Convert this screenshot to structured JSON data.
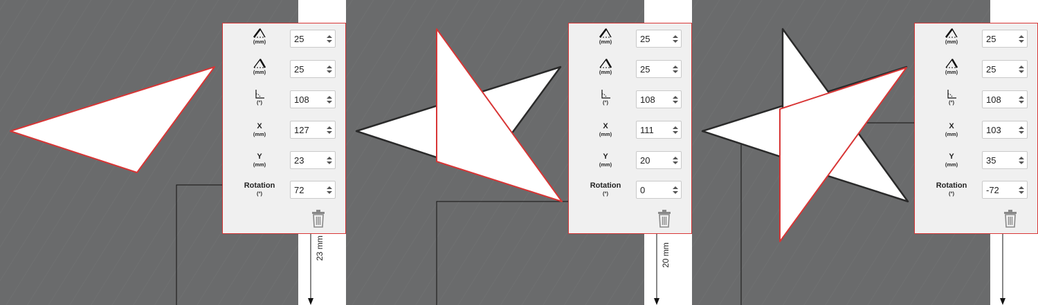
{
  "frames": [
    {
      "panel": {
        "side1": {
          "unit": "(mm)",
          "value": "25"
        },
        "side2": {
          "unit": "(mm)",
          "value": "25"
        },
        "angle": {
          "unit": "(°)",
          "value": "108"
        },
        "x": {
          "name": "X",
          "unit": "(mm)",
          "value": "127"
        },
        "y": {
          "name": "Y",
          "unit": "(mm)",
          "value": "23"
        },
        "rotation": {
          "name": "Rotation",
          "unit": "(°)",
          "value": "72"
        }
      },
      "dimension_label": "23 mm"
    },
    {
      "panel": {
        "side1": {
          "unit": "(mm)",
          "value": "25"
        },
        "side2": {
          "unit": "(mm)",
          "value": "25"
        },
        "angle": {
          "unit": "(°)",
          "value": "108"
        },
        "x": {
          "name": "X",
          "unit": "(mm)",
          "value": "111"
        },
        "y": {
          "name": "Y",
          "unit": "(mm)",
          "value": "20"
        },
        "rotation": {
          "name": "Rotation",
          "unit": "(°)",
          "value": "0"
        }
      },
      "dimension_label": "20 mm"
    },
    {
      "panel": {
        "side1": {
          "unit": "(mm)",
          "value": "25"
        },
        "side2": {
          "unit": "(mm)",
          "value": "25"
        },
        "angle": {
          "unit": "(°)",
          "value": "108"
        },
        "x": {
          "name": "X",
          "unit": "(mm)",
          "value": "103"
        },
        "y": {
          "name": "Y",
          "unit": "(mm)",
          "value": "35"
        },
        "rotation": {
          "name": "Rotation",
          "unit": "(°)",
          "value": "-72"
        }
      },
      "dimension_label": ""
    }
  ],
  "icons": {
    "side1": "triangle-side-length-icon",
    "side2": "triangle-side-length-icon",
    "angle": "angle-icon",
    "spinner": "spinner-arrows-icon",
    "delete": "trash-icon"
  },
  "colors": {
    "canvas": "#6a6b6c",
    "selected_outline": "#d83535",
    "shape_fill": "#ffffff",
    "shape_outline": "#2a2a2a",
    "panel_bg": "#f0f0f0"
  }
}
